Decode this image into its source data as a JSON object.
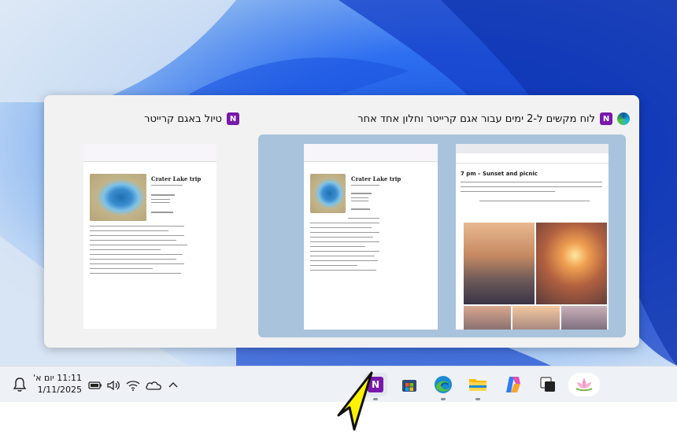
{
  "switcher": {
    "window1": {
      "title": "לוח מקשים ל-2 ימים עבור אגם קרייטר וחלון אחד אחר"
    },
    "window2": {
      "title": "טיול באגם קרייטר"
    },
    "browser_preview": {
      "heading": "7 pm – Sunset and picnic",
      "para": "Obviously, the best time to catch the sunset at Crater Lake would be the waterfront edge. We drove for several kilometers and I think Cloudcap Overlook is the best spot to enjoy the orange and rosy colours of the sky of the lake.",
      "para2": "Bring a coat, though – it can be super cold in here, also during the summer days!"
    },
    "notes_preview": {
      "title": "Crater Lake trip",
      "date": "Thursday, Oct 19th, 2023",
      "places_head": "Places to see",
      "places": [
        "Phantom ship",
        "Wizard island"
      ],
      "packing_head": "Packing list",
      "packing": [
        "Lightweight fuel",
        "Portable windproof and insulated jacket",
        "Wool socks",
        "Hiking Boots or Trail Runners (they look what to get)",
        "Check out our suggestions for Trail Shoes",
        "Sunglasses (Rimmed shades are best for blocking the bright sun)",
        "Long pants to keep warm (check item 3 for Bonus)",
        "Cozy warm shirt (Chances are the nights will be cold)",
        "Water filter or bottle with good size",
        "Sunscreen",
        "Storage Compression (Capsule organizer all of your items)"
      ]
    }
  },
  "taskbar": {
    "time": "11:11 יום א'",
    "date": "1/11/2025",
    "apps": [
      "onenote-app",
      "store-app",
      "edge-app",
      "file-explorer-app",
      "copilot-app",
      "task-view-app",
      "widgets-app"
    ]
  }
}
